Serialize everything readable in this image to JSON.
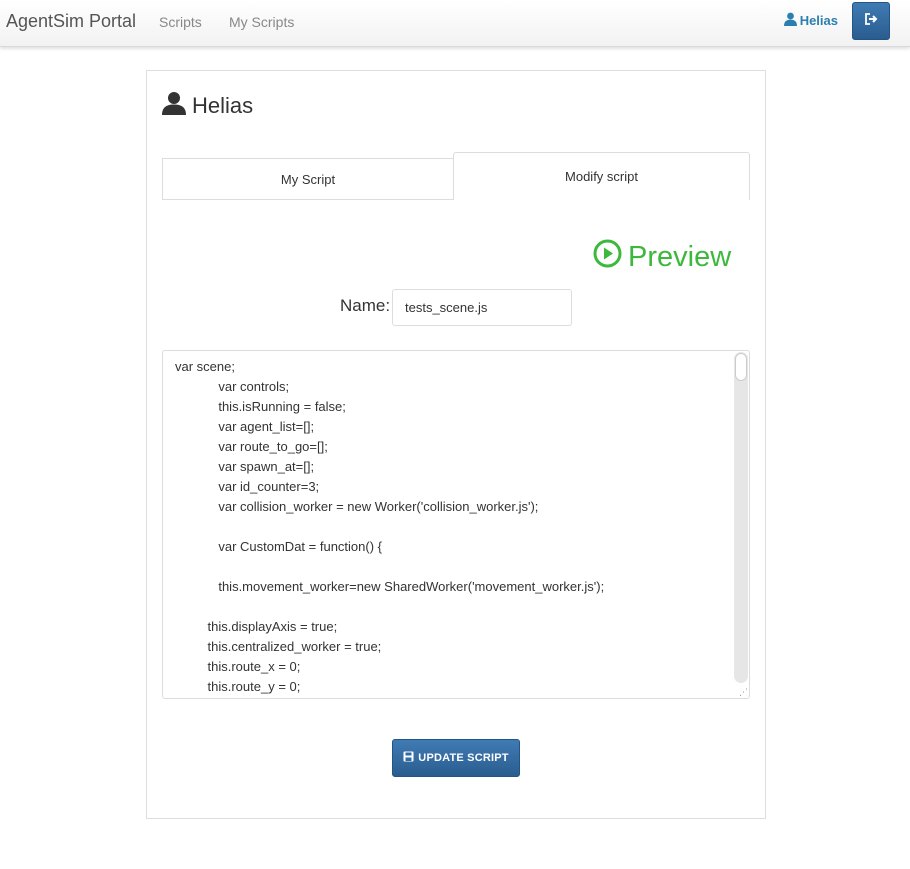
{
  "navbar": {
    "brand": "AgentSim Portal",
    "links": [
      "Scripts",
      "My Scripts"
    ],
    "user": "Helias",
    "user_icon": "user-icon",
    "logout_icon": "sign-out-icon"
  },
  "panel": {
    "title": "Helias",
    "title_icon": "user-icon"
  },
  "tabs": [
    {
      "label": "My Script",
      "active": false
    },
    {
      "label": "Modify script",
      "active": true
    }
  ],
  "preview": {
    "label": "Preview",
    "icon": "play-circle-icon",
    "color": "#3cb93c"
  },
  "form": {
    "name_label": "Name:",
    "name_value": "tests_scene.js"
  },
  "code": {
    "lines": [
      "var scene;",
      "            var controls;",
      "            this.isRunning = false;",
      "            var agent_list=[];",
      "            var route_to_go=[];",
      "            var spawn_at=[];",
      "            var id_counter=3;",
      "            var collision_worker = new Worker('collision_worker.js');",
      "",
      "            var CustomDat = function() {",
      "",
      "            this.movement_worker=new SharedWorker('movement_worker.js');",
      "",
      "         this.displayAxis = true;",
      "         this.centralized_worker = true;",
      "         this.route_x = 0;",
      "         this.route_y = 0;"
    ]
  },
  "update_button": {
    "label": "UPDATE SCRIPT",
    "icon": "floppy-disk-icon"
  },
  "colors": {
    "primary": "#2f6ca2",
    "link": "#2a7fb0",
    "success": "#3cb93c"
  }
}
